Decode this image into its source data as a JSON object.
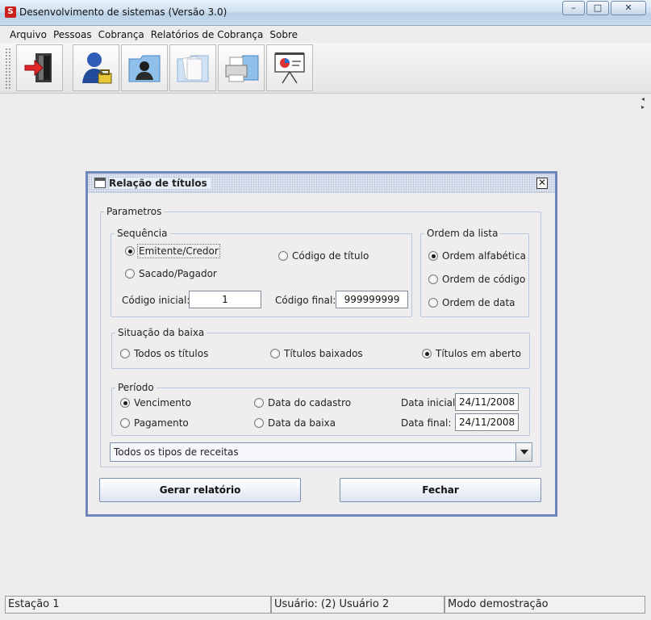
{
  "window": {
    "title": "Desenvolvimento de sistemas (Versão 3.0)",
    "app_icon_glyph": "S",
    "controls": {
      "minimize": "–",
      "maximize": "□",
      "close": "✕"
    }
  },
  "menu": [
    "Arquivo",
    "Pessoas",
    "Cobrança",
    "Relatórios de Cobrança",
    "Sobre"
  ],
  "toolbar": {
    "icons": [
      "exit-door-icon",
      "user-admin-icon",
      "person-folder-icon",
      "document-folder-icon",
      "printer-folder-icon",
      "presentation-chart-icon"
    ]
  },
  "dialog": {
    "title": "Relação de títulos",
    "close_glyph": "✕",
    "parametros": {
      "legend": "Parametros",
      "sequencia": {
        "legend": "Sequência",
        "options": [
          "Emitente/Credor",
          "Código de título",
          "Sacado/Pagador"
        ],
        "selected": "Emitente/Credor",
        "codigo_inicial_label": "Código inicial:",
        "codigo_inicial_value": "1",
        "codigo_final_label": "Código final:",
        "codigo_final_value": "999999999"
      },
      "ordem": {
        "legend": "Ordem da lista",
        "options": [
          "Ordem alfabética",
          "Ordem de código",
          "Ordem de data"
        ],
        "selected": "Ordem alfabética"
      },
      "situacao": {
        "legend": "Situação da baixa",
        "options": [
          "Todos os títulos",
          "Títulos baixados",
          "Títulos em aberto"
        ],
        "selected": "Títulos em aberto"
      },
      "periodo": {
        "legend": "Período",
        "options": [
          "Vencimento",
          "Data do cadastro",
          "Pagamento",
          "Data da baixa"
        ],
        "selected": "Vencimento",
        "data_inicial_label": "Data inicial:",
        "data_inicial_value": "24/11/2008",
        "data_final_label": "Data final:",
        "data_final_value": "24/11/2008"
      },
      "tipo_receita": "Todos os tipos de receitas"
    },
    "buttons": {
      "gerar": "Gerar relatório",
      "fechar": "Fechar"
    }
  },
  "status": {
    "estacao": "Estação 1",
    "usuario": "Usuário: (2) Usuário 2",
    "modo": "Modo demostração"
  }
}
